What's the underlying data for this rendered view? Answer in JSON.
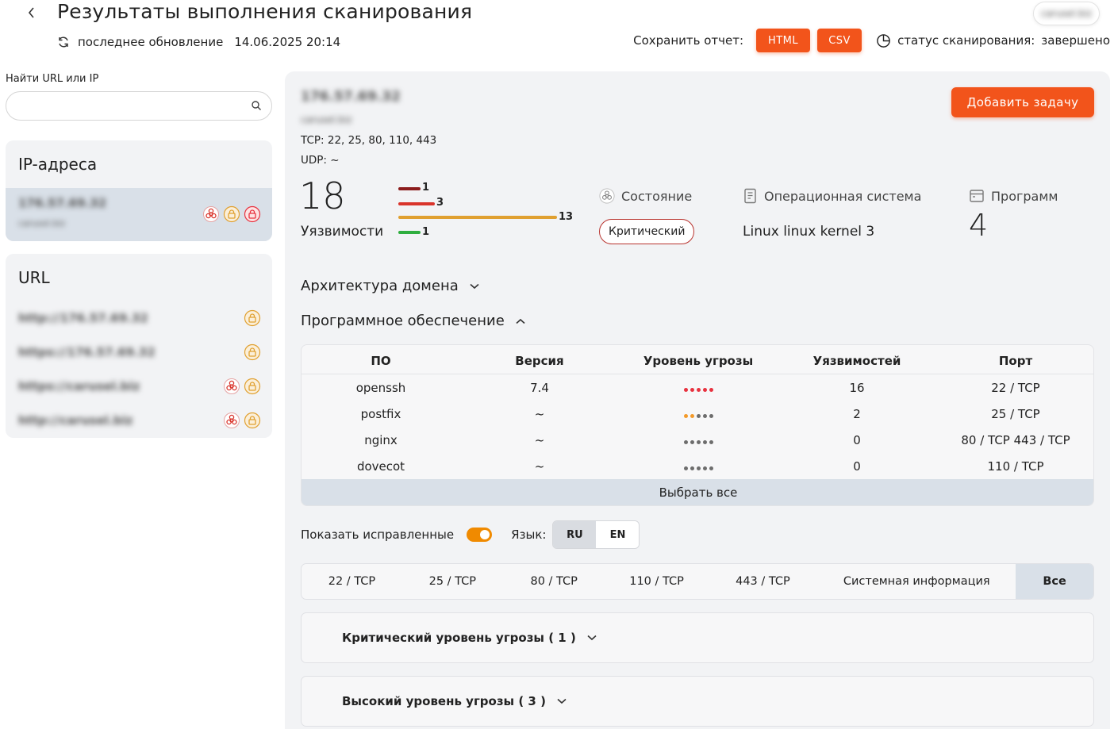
{
  "header": {
    "title": "Результаты выполнения сканирования",
    "updated_label": "последнее обновление",
    "updated_value": "14.06.2025 20:14",
    "user": "carusel.biz",
    "save_label": "Сохранить отчет:",
    "html_button": "HTML",
    "csv_button": "CSV",
    "status_label": "статус сканирования:",
    "status_value": "завершено"
  },
  "sidebar": {
    "search_label": "Найти URL или IP",
    "search_placeholder": "",
    "ip_title": "IP-адреса",
    "ip_items": [
      {
        "address": "176.57.69.32",
        "host": "carusel.biz"
      }
    ],
    "url_title": "URL",
    "url_items": [
      {
        "url": "http://176.57.69.32"
      },
      {
        "url": "https://176.57.69.32"
      },
      {
        "url": "https://carusel.biz"
      },
      {
        "url": "http://carusel.biz"
      }
    ]
  },
  "host": {
    "ip": "176.57.69.32",
    "name": "carusel.biz",
    "tcp": "TCP: 22, 25, 80, 110, 443",
    "udp": "UDP: ~",
    "add_task": "Добавить задачу"
  },
  "summary": {
    "vuln_total": "18",
    "vuln_label": "Уязвимости",
    "severity": [
      {
        "level": "critical",
        "count": 1,
        "color": "#8b1c1c"
      },
      {
        "level": "high",
        "count": 3,
        "color": "#d9342b"
      },
      {
        "level": "medium",
        "count": 13,
        "color": "#e0a030"
      },
      {
        "level": "low",
        "count": 1,
        "color": "#2fae3f"
      }
    ],
    "severity_max": 13,
    "state_label": "Состояние",
    "state_value": "Критический",
    "os_label": "Операционная система",
    "os_value": "Linux linux kernel 3",
    "programs_label": "Программ",
    "programs_value": "4"
  },
  "sections": {
    "architecture": "Архитектура домена",
    "software": "Программное обеспечение"
  },
  "software_table": {
    "columns": [
      "ПО",
      "Версия",
      "Уровень угрозы",
      "Уязвимостей",
      "Порт"
    ],
    "rows": [
      {
        "name": "openssh",
        "version": "7.4",
        "threat_colors": [
          "#e8323f",
          "#e8323f",
          "#e8323f",
          "#e8323f",
          "#e8323f"
        ],
        "vulns": "16",
        "port": "22 / TCP"
      },
      {
        "name": "postfix",
        "version": "~",
        "threat_colors": [
          "#f39a2a",
          "#f39a2a",
          "#6d6d6d",
          "#6d6d6d",
          "#6d6d6d"
        ],
        "vulns": "2",
        "port": "25 / TCP"
      },
      {
        "name": "nginx",
        "version": "~",
        "threat_colors": [
          "#6d6d6d",
          "#6d6d6d",
          "#6d6d6d",
          "#6d6d6d",
          "#6d6d6d"
        ],
        "vulns": "0",
        "port": "80 / TCP 443 / TCP"
      },
      {
        "name": "dovecot",
        "version": "~",
        "threat_colors": [
          "#6d6d6d",
          "#6d6d6d",
          "#6d6d6d",
          "#6d6d6d",
          "#6d6d6d"
        ],
        "vulns": "0",
        "port": "110 / TCP"
      }
    ],
    "select_all": "Выбрать все"
  },
  "filters": {
    "show_fixed": "Показать исправленные",
    "show_fixed_on": true,
    "lang_label": "Язык:",
    "langs": [
      "RU",
      "EN"
    ],
    "lang_active": "RU"
  },
  "port_tabs": [
    "22 / TCP",
    "25 / TCP",
    "80 / TCP",
    "110 / TCP",
    "443 / TCP",
    "Системная информация",
    "Все"
  ],
  "threat_groups": [
    "Критический уровень угрозы ( 1 )",
    "Высокий уровень угрозы ( 3 )"
  ],
  "colors": {
    "accent": "#f2541b",
    "toggle": "#f08a00",
    "critical_border": "#b8322d",
    "panel": "#f2f3f5",
    "selected": "#d9e0e8"
  }
}
